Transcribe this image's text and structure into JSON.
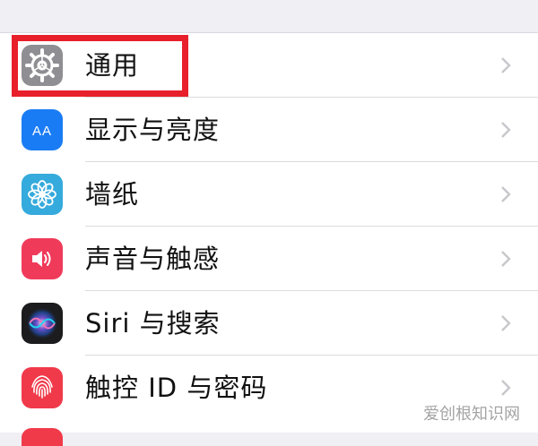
{
  "settings": {
    "rows": [
      {
        "label": "通用",
        "icon": "gear-icon",
        "color": "#8e8e93"
      },
      {
        "label": "显示与亮度",
        "icon": "text-size-icon",
        "color": "#1a7cf5"
      },
      {
        "label": "墙纸",
        "icon": "flower-icon",
        "color": "#35aadc"
      },
      {
        "label": "声音与触感",
        "icon": "speaker-icon",
        "color": "#f03a5a"
      },
      {
        "label": "Siri 与搜索",
        "icon": "siri-icon",
        "color": "#1c1c1e"
      },
      {
        "label": "触控 ID 与密码",
        "icon": "fingerprint-icon",
        "color": "#f03a4a"
      }
    ],
    "display_icon_text": "AA"
  },
  "annotation": {
    "highlight_color": "#e8202c"
  },
  "watermark": "爱创根知识网"
}
